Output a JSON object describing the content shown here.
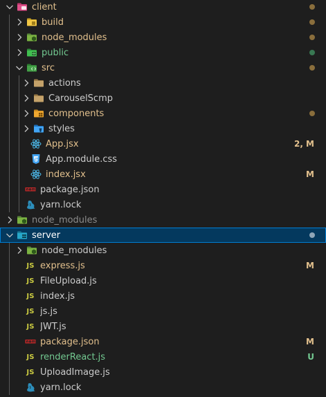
{
  "colors": {
    "modified": "#e2c08d",
    "untracked": "#73c991",
    "ignored": "#8c8c8c",
    "normal": "#cccccc",
    "dot_modified": "#8a6e3c",
    "dot_untracked": "#397852",
    "selection_bg": "#04395e",
    "selection_border": "#007fd4"
  },
  "tree": [
    {
      "label": "client",
      "level": 0,
      "type": "folder",
      "expanded": true,
      "icon": "client-folder-icon",
      "status": "modified",
      "dot": true
    },
    {
      "label": "build",
      "level": 1,
      "type": "folder",
      "expanded": false,
      "icon": "build-folder-icon",
      "status": "modified",
      "dot": true
    },
    {
      "label": "node_modules",
      "level": 1,
      "type": "folder",
      "expanded": false,
      "icon": "node-folder-icon",
      "status": "modified",
      "dot": true
    },
    {
      "label": "public",
      "level": 1,
      "type": "folder",
      "expanded": false,
      "icon": "public-folder-icon",
      "status": "untracked",
      "dot": true
    },
    {
      "label": "src",
      "level": 1,
      "type": "folder",
      "expanded": true,
      "icon": "src-folder-icon",
      "status": "modified",
      "dot": true
    },
    {
      "label": "actions",
      "level": 2,
      "type": "folder",
      "expanded": false,
      "icon": "folder-icon",
      "status": "normal"
    },
    {
      "label": "CarouselScmp",
      "level": 2,
      "type": "folder",
      "expanded": false,
      "icon": "folder-icon",
      "status": "normal"
    },
    {
      "label": "components",
      "level": 2,
      "type": "folder",
      "expanded": false,
      "icon": "components-folder-icon",
      "status": "modified",
      "dot": true
    },
    {
      "label": "styles",
      "level": 2,
      "type": "folder",
      "expanded": false,
      "icon": "styles-folder-icon",
      "status": "normal"
    },
    {
      "label": "App.jsx",
      "level": 3,
      "type": "file",
      "icon": "react-icon",
      "status": "modified",
      "badge": "2, M"
    },
    {
      "label": "App.module.css",
      "level": 3,
      "type": "file",
      "icon": "css-icon",
      "status": "normal"
    },
    {
      "label": "index.jsx",
      "level": 3,
      "type": "file",
      "icon": "react-icon",
      "status": "modified",
      "badge": "M"
    },
    {
      "label": "package.json",
      "level": 2,
      "type": "file",
      "icon": "npm-icon",
      "status": "normal"
    },
    {
      "label": "yarn.lock",
      "level": 2,
      "type": "file",
      "icon": "yarn-icon",
      "status": "normal"
    },
    {
      "label": "node_modules",
      "level": 0,
      "type": "folder",
      "expanded": false,
      "icon": "node-folder-icon",
      "status": "ignored"
    },
    {
      "label": "server",
      "level": 0,
      "type": "folder",
      "expanded": true,
      "icon": "server-folder-icon",
      "status": "normal",
      "selected": true,
      "dot": true,
      "dot_color": "#8fa6b8"
    },
    {
      "label": "node_modules",
      "level": 1,
      "type": "folder",
      "expanded": false,
      "icon": "node-folder-icon",
      "status": "normal"
    },
    {
      "label": "express.js",
      "level": 2,
      "type": "file",
      "icon": "js-icon",
      "icon_text": "JS",
      "status": "modified",
      "badge": "M"
    },
    {
      "label": "FileUpload.js",
      "level": 2,
      "type": "file",
      "icon": "js-icon",
      "icon_text": "JS",
      "status": "normal"
    },
    {
      "label": "index.js",
      "level": 2,
      "type": "file",
      "icon": "js-icon",
      "icon_text": "JS",
      "status": "normal"
    },
    {
      "label": "js.js",
      "level": 2,
      "type": "file",
      "icon": "js-icon",
      "icon_text": "JS",
      "status": "normal"
    },
    {
      "label": "JWT.js",
      "level": 2,
      "type": "file",
      "icon": "js-icon",
      "icon_text": "JS",
      "status": "normal"
    },
    {
      "label": "package.json",
      "level": 2,
      "type": "file",
      "icon": "npm-icon",
      "status": "modified",
      "badge": "M"
    },
    {
      "label": "renderReact.js",
      "level": 2,
      "type": "file",
      "icon": "js-icon",
      "icon_text": "JS",
      "status": "untracked",
      "badge": "U"
    },
    {
      "label": "UploadImage.js",
      "level": 2,
      "type": "file",
      "icon": "js-icon",
      "icon_text": "JS",
      "status": "normal"
    },
    {
      "label": "yarn.lock",
      "level": 2,
      "type": "file",
      "icon": "yarn-icon",
      "status": "normal"
    }
  ]
}
